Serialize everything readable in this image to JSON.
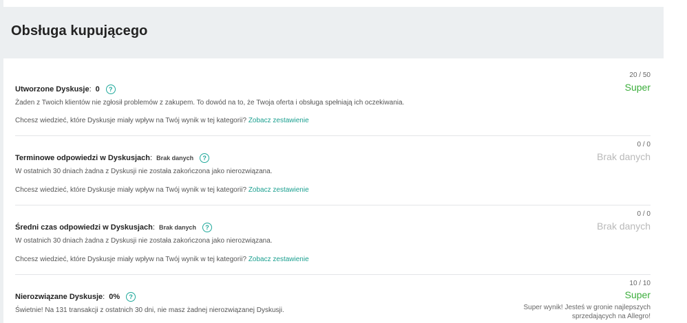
{
  "section_title": "Obsługa kupującego",
  "colors": {
    "accent": "#1ea89a",
    "good": "#3cae3c",
    "muted": "#b9b9b9"
  },
  "items": [
    {
      "label": "Utworzone Dyskusje",
      "value": "0",
      "score": "20 / 50",
      "status": "Super",
      "description": "Żaden z Twoich klientów nie zgłosił problemów z zakupem. To dowód na to, że Twoja oferta i obsługa spełniają ich oczekiwania.",
      "hint": "Chcesz wiedzieć, które Dyskusje miały wpływ na Twój wynik w tej kategorii?",
      "link": "Zobacz zestawienie"
    },
    {
      "label": "Terminowe odpowiedzi w Dyskusjach",
      "value": "Brak danych",
      "score": "0 / 0",
      "status": "Brak danych",
      "description": "W ostatnich 30 dniach żadna z Dyskusji nie została zakończona jako nierozwiązana.",
      "hint": "Chcesz wiedzieć, które Dyskusje miały wpływ na Twój wynik w tej kategorii?",
      "link": "Zobacz zestawienie"
    },
    {
      "label": "Średni czas odpowiedzi w Dyskusjach",
      "value": "Brak danych",
      "score": "0 / 0",
      "status": "Brak danych",
      "description": "W ostatnich 30 dniach żadna z Dyskusji nie została zakończona jako nierozwiązana.",
      "hint": "Chcesz wiedzieć, które Dyskusje miały wpływ na Twój wynik w tej kategorii?",
      "link": "Zobacz zestawienie"
    },
    {
      "label": "Nierozwiązane Dyskusje",
      "value": "0%",
      "score": "10 / 10",
      "status": "Super",
      "description": "Świetnie! Na 131 transakcji z ostatnich 30 dni, nie masz żadnej nierozwiązanej Dyskusji.",
      "note": "Super wynik! Jesteś w gronie najlepszych sprzedających na Allegro!"
    }
  ],
  "help_icon_glyph": "?",
  "colon": ":"
}
